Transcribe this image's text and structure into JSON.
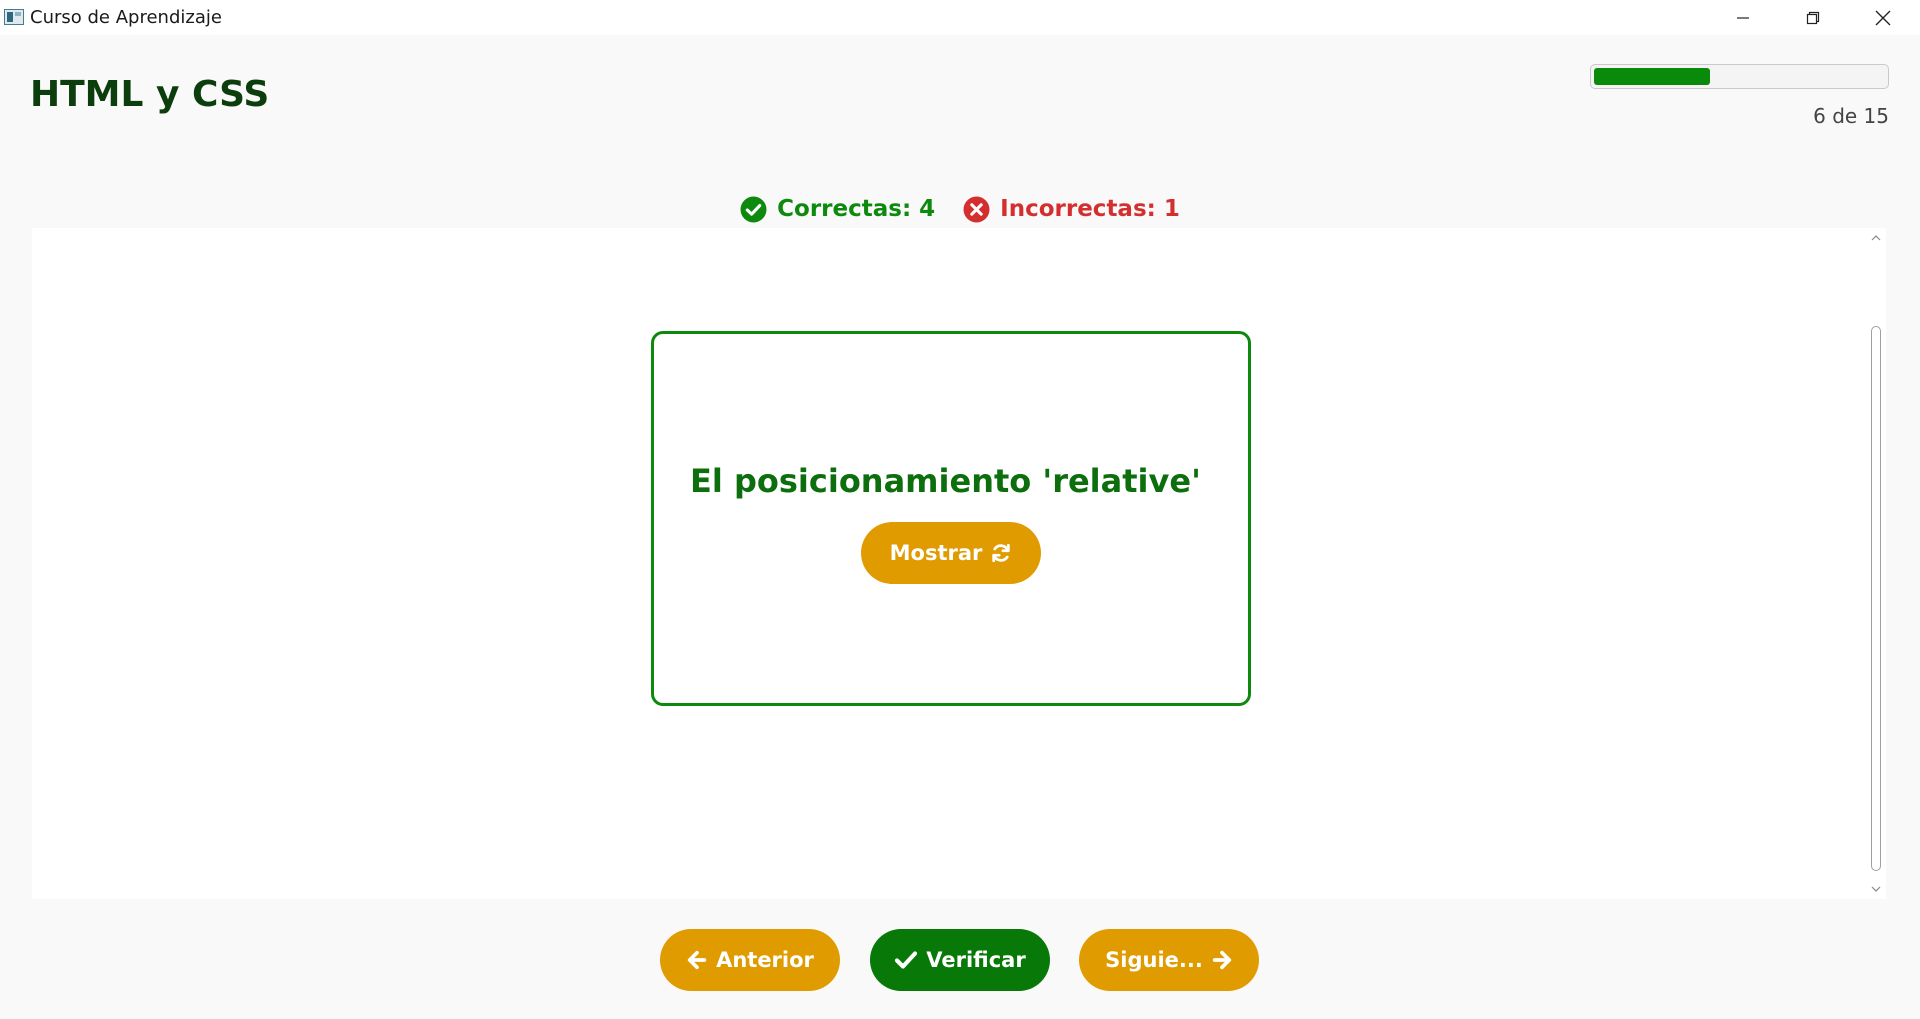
{
  "window": {
    "title": "Curso de Aprendizaje"
  },
  "header": {
    "course_title": "HTML y CSS",
    "progress": {
      "current": 6,
      "total": 15,
      "label": "6 de 15",
      "fill_fraction": 0.4
    }
  },
  "score": {
    "correct_label": "Correctas: 4",
    "incorrect_label": "Incorrectas: 1",
    "correct_icon": "check-circle-icon",
    "incorrect_icon": "x-circle-icon"
  },
  "card": {
    "text": "El posicionamiento 'relative'",
    "show_button": "Mostrar",
    "show_icon": "refresh-icon"
  },
  "footer": {
    "prev_label": "Anterior",
    "verify_label": "Verificar",
    "next_label": "Siguie..."
  },
  "colors": {
    "accent_orange": "#e09b00",
    "success_green": "#0d8a0d",
    "error_red": "#d32f2f",
    "title_green": "#0c3d0c"
  }
}
